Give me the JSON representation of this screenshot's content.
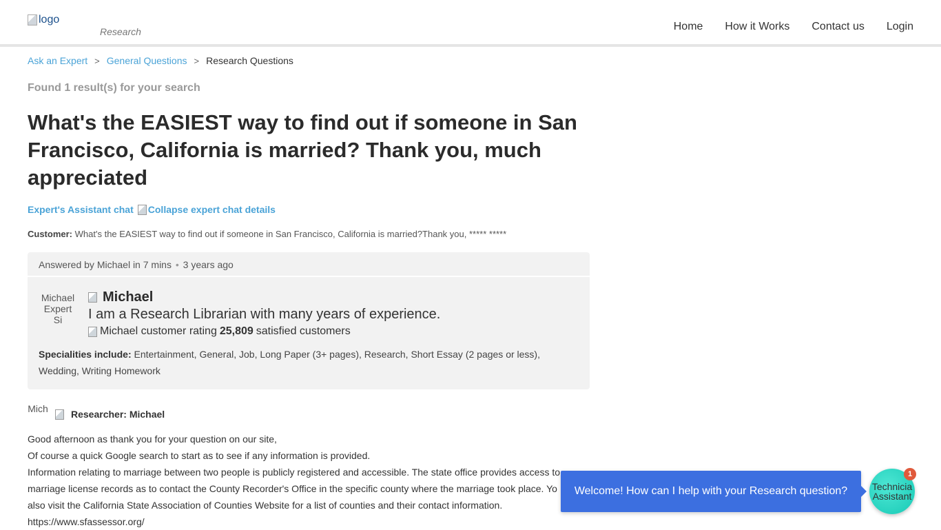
{
  "header": {
    "logo_alt": "logo",
    "logo_sub": "Research",
    "nav": [
      "Home",
      "How it Works",
      "Contact us",
      "Login"
    ]
  },
  "breadcrumb": {
    "items": [
      "Ask an Expert",
      "General Questions"
    ],
    "current": "Research Questions",
    "separator": ">"
  },
  "found_text": "Found 1 result(s) for your search",
  "question": {
    "title": "What's the EASIEST way to find out if someone in San Francisco, California is married? Thank you, much appreciated"
  },
  "chat_toggle": {
    "label": "Expert's Assistant chat",
    "collapse_alt": "Collapse expert chat details"
  },
  "customer": {
    "label": "Customer:",
    "text": "What's the EASIEST way to find out if someone in San Francisco, California is married?Thank you, ***** *****"
  },
  "answer_card": {
    "answered_by": "Answered by Michael in 7 mins",
    "time_ago": "3 years ago",
    "avatar_alt": "Michael Expert Si",
    "expert_name": "Michael",
    "bio": "I am a Research Librarian with many years of experience.",
    "rating_alt": "Michael customer rating",
    "satisfied_count": "25,809",
    "satisfied_label": "satisfied customers",
    "specialities_label": "Specialities include:",
    "specialities": "Entertainment, General, Job, Long Paper (3+ pages), Research, Short Essay (2 pages or less), Wedding, Writing Homework"
  },
  "researcher": {
    "avatar_alt": "Mich",
    "label": "Researcher: Michael"
  },
  "answer_body": [
    "Good afternoon as thank you for your question on our site,",
    "Of course a quick Google search to start as to see if any information is provided.",
    "Information relating to marriage between two people is publicly registered and accessible. The state office provides access to",
    "marriage license records as to contact the County Recorder's Office in the specific county where the marriage took place.  Yo",
    "also visit the California State Association of Counties Website for a list of counties and their contact information.",
    "https://www.sfassessor.org/"
  ],
  "chat_widget": {
    "message": "Welcome! How can I help with your Research question?",
    "assistant_alt": "Technicia Assistant",
    "badge_count": "1"
  },
  "colors": {
    "link": "#4aa3d7",
    "chat_bubble": "#3c6fe0",
    "assistant": "#16c9b5",
    "badge": "#e05a3c"
  }
}
